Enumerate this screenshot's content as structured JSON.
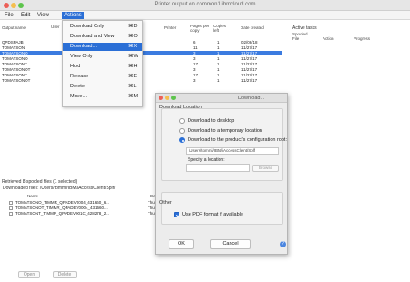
{
  "window": {
    "title": "Printer output on common1.ibmcloud.com"
  },
  "menubar": {
    "items": [
      "File",
      "Edit",
      "View",
      "Actions"
    ]
  },
  "actions_menu": {
    "items": [
      {
        "label": "Download Only",
        "shortcut": "⌘D"
      },
      {
        "label": "Download and View",
        "shortcut": "⌘O"
      },
      {
        "label": "Download...",
        "shortcut": "⌘X"
      },
      {
        "label": "View Only",
        "shortcut": "⌘W"
      },
      {
        "label": "Hold",
        "shortcut": "⌘H"
      },
      {
        "label": "Release",
        "shortcut": "⌘E"
      },
      {
        "label": "Delete",
        "shortcut": "⌘L"
      },
      {
        "label": "Move...",
        "shortcut": "⌘M"
      }
    ]
  },
  "output_table": {
    "headers": [
      "Output name",
      "User",
      "Printer",
      "Pages per copy",
      "Copies left",
      "Date created"
    ],
    "rows": [
      {
        "name": "QPDSPAJB",
        "pages": "6",
        "copies": "1",
        "date": "02/08/18"
      },
      {
        "name": "TOMATSON",
        "pages": "11",
        "copies": "1",
        "date": "11/27/17"
      },
      {
        "name": "TOMATSONO",
        "pages": "3",
        "copies": "1",
        "date": "11/27/17"
      },
      {
        "name": "TOMATSONO",
        "pages": "3",
        "copies": "1",
        "date": "11/27/17"
      },
      {
        "name": "TOMATSONT",
        "pages": "17",
        "copies": "1",
        "date": "11/27/17"
      },
      {
        "name": "TOMATSONOT",
        "pages": "3",
        "copies": "1",
        "date": "11/27/17"
      },
      {
        "name": "TOMATSONT",
        "pages": "17",
        "copies": "1",
        "date": "11/27/17"
      },
      {
        "name": "TOMATSONOT",
        "pages": "3",
        "copies": "1",
        "date": "11/27/17"
      }
    ]
  },
  "retrieved_title": "Retrieved 8 spooled files (1 selected)",
  "downloaded_files": {
    "path_label": "Downloaded files: /Users/tommi/IBM/iAccessClient/Splf/",
    "headers": [
      "Name",
      "Date"
    ],
    "rows": [
      {
        "name": "TOMATSONO_TIMMR_QPADEV0004_431660_6...",
        "time": "Thur"
      },
      {
        "name": "TOMATSONOT_TIMMR_QPADEV0004_431660...",
        "time": "Thur"
      },
      {
        "name": "TOMATSONT_TIMMR_QPADEV001C_428278_2...",
        "time": "Thur"
      }
    ],
    "open_label": "Open",
    "delete_label": "Delete"
  },
  "active_tasks": {
    "title": "Active tasks",
    "headers": [
      "Spooled File",
      "Action",
      "Progress"
    ]
  },
  "dialog": {
    "title": "Download...",
    "location_group": "Download Location",
    "options": [
      "Download to desktop",
      "Download to a temporary location",
      "Download to the product's configuration root:"
    ],
    "selected_option": 2,
    "path_value": "/Users/tommi/IBM/iAccessClient/Splf",
    "specify_label": "Specify a location:",
    "browse_label": "Browse",
    "other_group": "Other",
    "pdf_label": "Use PDF format if available",
    "ok_label": "OK",
    "cancel_label": "Cancel"
  }
}
